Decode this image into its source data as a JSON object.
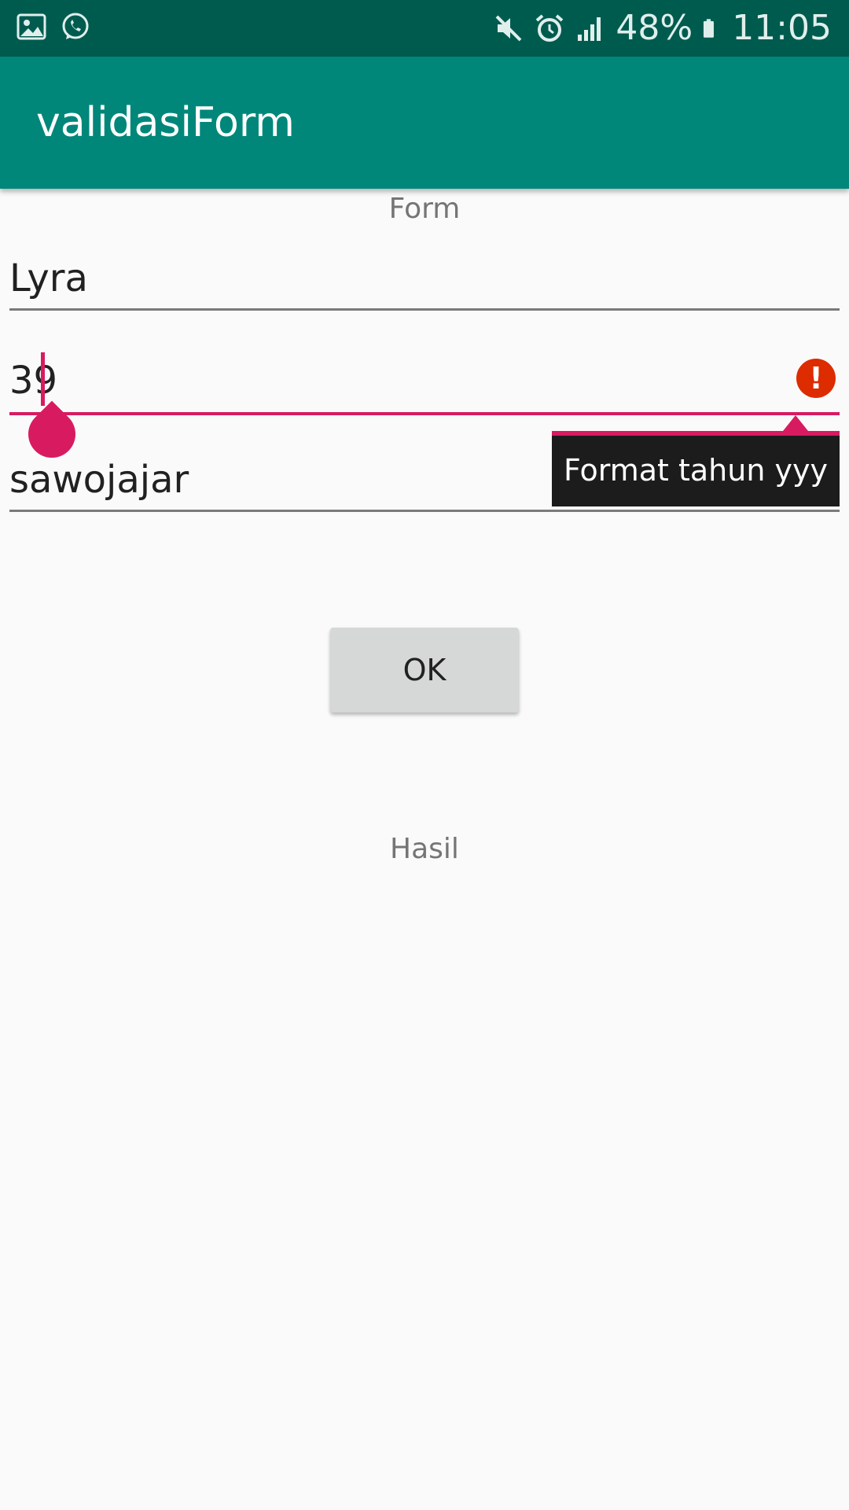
{
  "status_bar": {
    "left_icons": [
      "gallery-icon",
      "whatsapp-icon"
    ],
    "right_icons": [
      "mute-icon",
      "alarm-icon",
      "signal-icon",
      "battery-icon"
    ],
    "battery": "48%",
    "time": "11:05"
  },
  "app_bar": {
    "title": "validasiForm"
  },
  "form": {
    "heading": "Form",
    "name_value": "Lyra",
    "year_value": "39",
    "address_value": "sawojajar",
    "error_tooltip": "Format tahun yyy",
    "error_icon": "!"
  },
  "ok_button": {
    "label": "OK"
  },
  "result": {
    "label": "Hasil"
  },
  "colors": {
    "status_bar": "#005b4f",
    "app_bar": "#00877a",
    "accent": "#d81b60",
    "error": "#dd2c00"
  }
}
